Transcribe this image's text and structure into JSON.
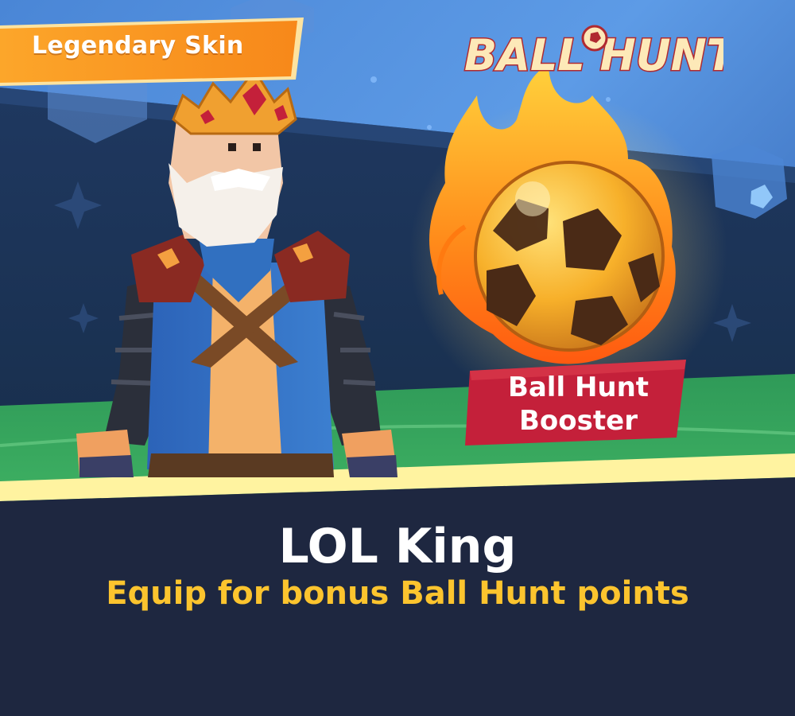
{
  "game": {
    "logo_text": "BALL HUNT",
    "badge_label": "Legendary Skin",
    "booster_label_line1": "Ball Hunt",
    "booster_label_line2": "Booster",
    "skin_name": "LOL King",
    "skin_description": "Equip for bonus Ball Hunt points"
  },
  "icons": {
    "character": "king-character-icon",
    "ball": "flaming-soccer-ball-icon",
    "logo_ball": "soccer-ball-icon"
  },
  "colors": {
    "badge_orange": "#f98a1e",
    "booster_red": "#c4203a",
    "panel_navy": "#1e2740",
    "subtitle_yellow": "#fcc42e",
    "stripe_yellow": "#fff3a0"
  }
}
